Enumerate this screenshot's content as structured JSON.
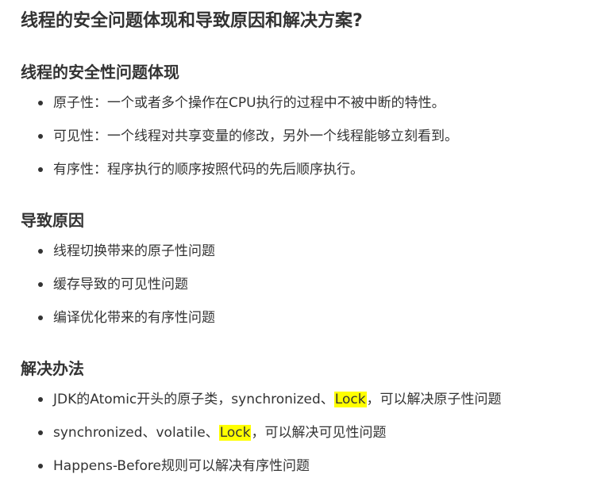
{
  "title": "线程的安全问题体现和导致原因和解决方案?",
  "sections": [
    {
      "heading": "线程的安全性问题体现",
      "items": [
        "原子性：一个或者多个操作在CPU执行的过程中不被中断的特性。",
        "可见性：一个线程对共享变量的修改，另外一个线程能够立刻看到。",
        "有序性：程序执行的顺序按照代码的先后顺序执行。"
      ]
    },
    {
      "heading": "导致原因",
      "items": [
        "线程切换带来的原子性问题",
        "缓存导致的可见性问题",
        "编译优化带来的有序性问题"
      ]
    },
    {
      "heading": "解决办法",
      "items": [
        {
          "before": "JDK的Atomic开头的原子类，synchronized、",
          "highlight": "Lock",
          "after": "，可以解决原子性问题"
        },
        {
          "before": "synchronized、volatile、",
          "highlight": "Lock",
          "after": "，可以解决可见性问题"
        },
        "Happens-Before规则可以解决有序性问题"
      ]
    }
  ],
  "colors": {
    "text": "#333333",
    "highlight": "#ffff00"
  }
}
